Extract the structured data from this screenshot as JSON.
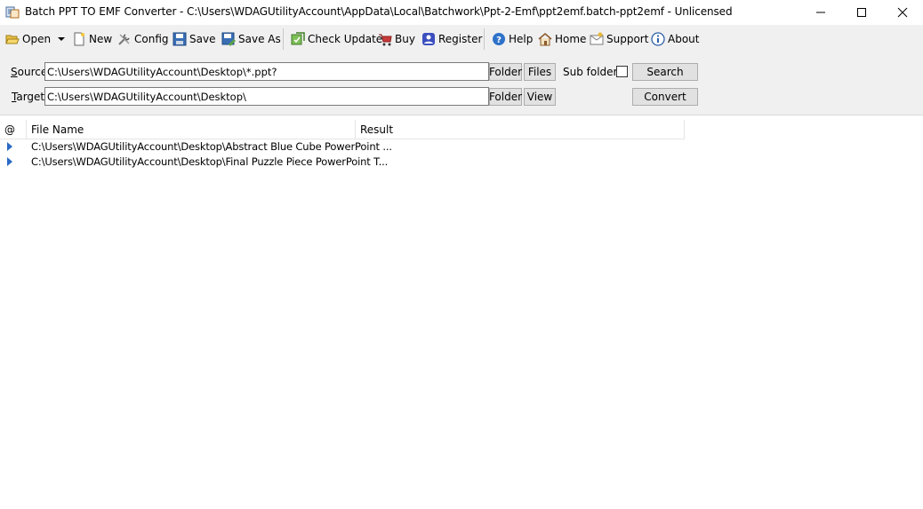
{
  "window": {
    "title": "Batch PPT TO EMF Converter - C:\\Users\\WDAGUtilityAccount\\AppData\\Local\\Batchwork\\Ppt-2-Emf\\ppt2emf.batch-ppt2emf - Unlicensed",
    "icon": "app-icon"
  },
  "toolbar": {
    "open": "Open",
    "new": "New",
    "config": "Config",
    "save": "Save",
    "save_as": "Save As",
    "check_update": "Check Update",
    "buy": "Buy",
    "register": "Register",
    "help": "Help",
    "home": "Home",
    "support": "Support",
    "about": "About"
  },
  "source": {
    "label_accel": "S",
    "label_rest": "ource",
    "value": "C:\\Users\\WDAGUtilityAccount\\Desktop\\*.ppt?",
    "folder_btn": "Folder",
    "files_btn": "Files",
    "subfolders_label": "Sub folders",
    "subfolders_checked": false,
    "search_btn": "Search"
  },
  "target": {
    "label_accel": "T",
    "label_rest": "arget",
    "value": "C:\\Users\\WDAGUtilityAccount\\Desktop\\",
    "folder_btn": "Folder",
    "view_btn": "View",
    "convert_btn": "Convert"
  },
  "list": {
    "columns": [
      "@",
      "File Name",
      "Result"
    ],
    "rows": [
      {
        "file": "C:\\Users\\WDAGUtilityAccount\\Desktop\\Abstract Blue Cube PowerPoint ...",
        "result": ""
      },
      {
        "file": "C:\\Users\\WDAGUtilityAccount\\Desktop\\Final Puzzle Piece PowerPoint T...",
        "result": ""
      }
    ]
  },
  "colors": {
    "accent": "#2a6ac4",
    "toolbar_bg": "#f0f0f0"
  }
}
